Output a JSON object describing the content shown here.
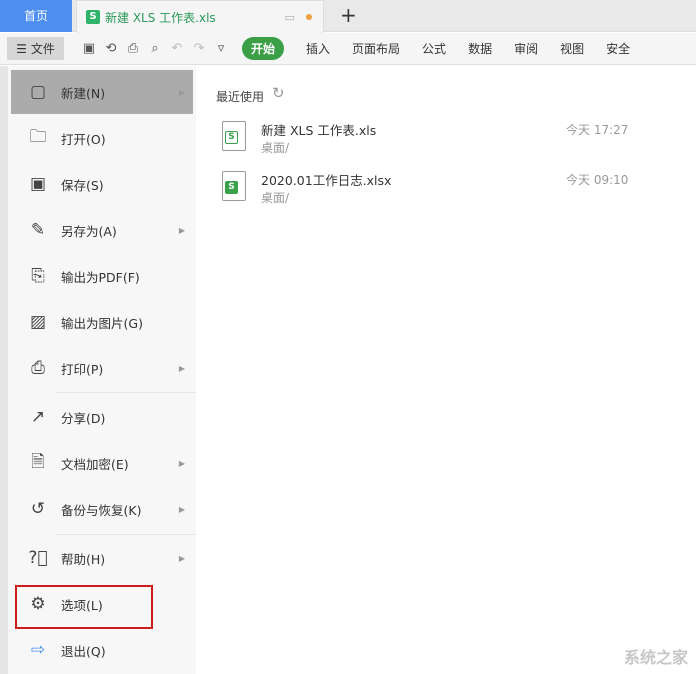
{
  "tabs": {
    "home": "首页",
    "doc": "新建 XLS 工作表.xls",
    "add": "+"
  },
  "toolbar": {
    "file": "文件",
    "start": "开始",
    "ribbon": [
      "插入",
      "页面布局",
      "公式",
      "数据",
      "审阅",
      "视图",
      "安全"
    ]
  },
  "menu": [
    {
      "label": "新建(N)",
      "icon": "new-file-icon",
      "arrow": true
    },
    {
      "label": "打开(O)",
      "icon": "folder-icon",
      "arrow": false
    },
    {
      "label": "保存(S)",
      "icon": "save-icon",
      "arrow": false
    },
    {
      "label": "另存为(A)",
      "icon": "save-as-icon",
      "arrow": true
    },
    {
      "label": "输出为PDF(F)",
      "icon": "pdf-icon",
      "arrow": false
    },
    {
      "label": "输出为图片(G)",
      "icon": "image-icon",
      "arrow": false
    },
    {
      "label": "打印(P)",
      "icon": "print-icon",
      "arrow": true
    },
    {
      "label": "分享(D)",
      "icon": "share-icon",
      "arrow": false
    },
    {
      "label": "文档加密(E)",
      "icon": "encrypt-icon",
      "arrow": true
    },
    {
      "label": "备份与恢复(K)",
      "icon": "backup-icon",
      "arrow": true
    },
    {
      "label": "帮助(H)",
      "icon": "help-icon",
      "arrow": true
    },
    {
      "label": "选项(L)",
      "icon": "gear-icon",
      "arrow": false
    },
    {
      "label": "退出(Q)",
      "icon": "exit-icon",
      "arrow": false
    }
  ],
  "recent": {
    "title": "最近使用",
    "files": [
      {
        "name": "新建 XLS 工作表.xls",
        "path": "桌面/",
        "time": "今天 17:27"
      },
      {
        "name": "2020.01工作日志.xlsx",
        "path": "桌面/",
        "time": "今天 09:10"
      }
    ]
  },
  "watermark": "系统之家"
}
